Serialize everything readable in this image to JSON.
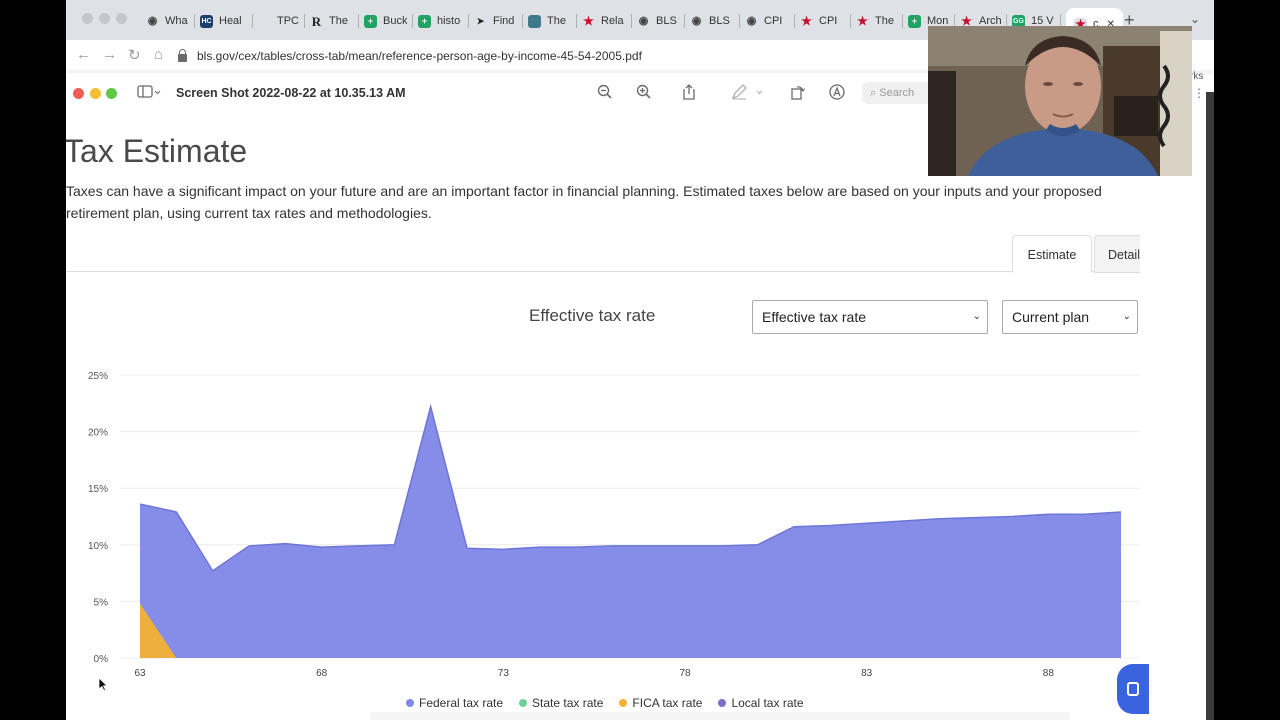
{
  "browser": {
    "tabs": [
      {
        "label": "Wha",
        "icon": "google-icon"
      },
      {
        "label": "Heal",
        "icon": "hc-icon"
      },
      {
        "label": "TPC",
        "icon": "tpc-icon"
      },
      {
        "label": "The",
        "icon": "r-icon"
      },
      {
        "label": "Buck",
        "icon": "sheets-icon"
      },
      {
        "label": "histo",
        "icon": "sheets-icon"
      },
      {
        "label": "Find",
        "icon": "find-icon"
      },
      {
        "label": "The",
        "icon": "page-icon"
      },
      {
        "label": "Rela",
        "icon": "star-icon"
      },
      {
        "label": "BLS",
        "icon": "globe-icon"
      },
      {
        "label": "BLS",
        "icon": "globe-icon"
      },
      {
        "label": "CPI",
        "icon": "globe-icon"
      },
      {
        "label": "CPI",
        "icon": "star-icon"
      },
      {
        "label": "The",
        "icon": "star-icon"
      },
      {
        "label": "Mon",
        "icon": "sheets-icon"
      },
      {
        "label": "Arch",
        "icon": "star-icon"
      },
      {
        "label": "15 V",
        "icon": "gg-icon"
      },
      {
        "label": "c",
        "icon": "star-icon"
      }
    ],
    "url": "bls.gov/cex/tables/cross-tab/mean/reference-person-age-by-income-45-54-2005.pdf",
    "bookmarks_label": "rks"
  },
  "preview": {
    "doc_title": "Screen Shot 2022-08-22 at 10.35.13 AM",
    "search_placeholder": "Search"
  },
  "page": {
    "title": "Tax Estimate",
    "description": "Taxes can have a significant impact on your future and are an important factor in financial planning. Estimated taxes below are based on your inputs and your proposed retirement plan, using current tax rates and methodologies.",
    "tabs": {
      "estimate": "Estimate",
      "detail": "Detail"
    },
    "chart_heading": "Effective tax rate",
    "metric_select": "Effective tax rate",
    "plan_select": "Current plan"
  },
  "colors": {
    "federal": "#7f87e8",
    "state": "#6fcf97",
    "fica": "#f2b233",
    "local": "#7b6fc9"
  },
  "chart_data": {
    "type": "area",
    "title": "Effective tax rate",
    "xlabel": "",
    "ylabel": "",
    "x": [
      63,
      64,
      65,
      66,
      67,
      68,
      69,
      70,
      71,
      72,
      73,
      74,
      75,
      76,
      77,
      78,
      79,
      80,
      81,
      82,
      83,
      84,
      85,
      86,
      87,
      88,
      89,
      90
    ],
    "xticks": [
      "63",
      "68",
      "73",
      "78",
      "83",
      "88"
    ],
    "yticks": [
      "0%",
      "5%",
      "10%",
      "15%",
      "20%",
      "25%"
    ],
    "ylim": [
      0,
      25
    ],
    "grid": true,
    "legend": "bottom",
    "series": [
      {
        "name": "Federal tax rate",
        "values": [
          13.6,
          12.9,
          7.7,
          9.9,
          10.1,
          9.8,
          9.9,
          10.0,
          22.2,
          9.7,
          9.6,
          9.8,
          9.8,
          9.9,
          9.9,
          9.9,
          9.9,
          10.0,
          11.6,
          11.7,
          11.9,
          12.1,
          12.3,
          12.4,
          12.5,
          12.7,
          12.7,
          12.9
        ]
      },
      {
        "name": "State tax rate",
        "values": [
          0,
          0,
          0,
          0,
          0,
          0,
          0,
          0,
          0,
          0,
          0,
          0,
          0,
          0,
          0,
          0,
          0,
          0,
          0,
          0,
          0,
          0,
          0,
          0,
          0,
          0,
          0,
          0
        ]
      },
      {
        "name": "FICA tax rate",
        "values": [
          4.8,
          0,
          0,
          0,
          0,
          0,
          0,
          0,
          0,
          0,
          0,
          0,
          0,
          0,
          0,
          0,
          0,
          0,
          0,
          0,
          0,
          0,
          0,
          0,
          0,
          0,
          0,
          0
        ]
      },
      {
        "name": "Local tax rate",
        "values": [
          0,
          0,
          0,
          0,
          0,
          0,
          0,
          0,
          0,
          0,
          0,
          0,
          0,
          0,
          0,
          0,
          0,
          0,
          0,
          0,
          0,
          0,
          0,
          0,
          0,
          0,
          0,
          0
        ]
      }
    ]
  }
}
